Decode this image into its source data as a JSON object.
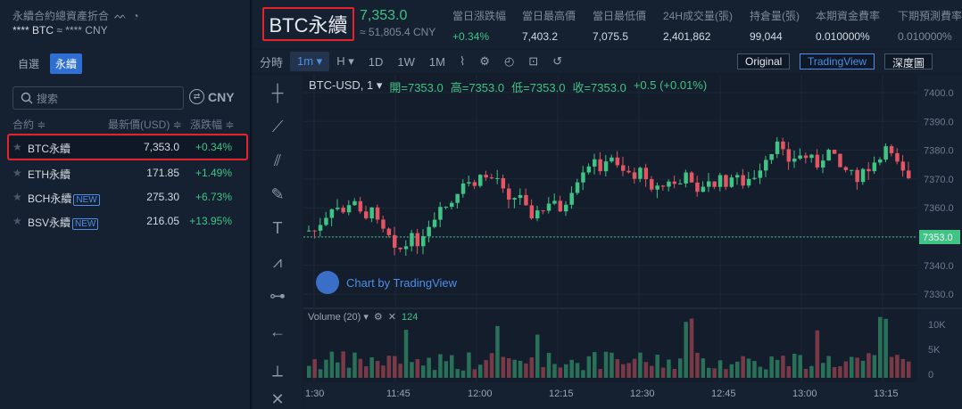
{
  "sidebar": {
    "title": "永續合約總資產折合",
    "balance_btc": "**** BTC",
    "balance_cny": "≈ **** CNY",
    "tabs": [
      {
        "label": "自選"
      },
      {
        "label": "永續"
      }
    ],
    "search_placeholder": "搜索",
    "currency": "CNY",
    "columns": {
      "contract": "合約 ≑",
      "price": "最新價(USD) ≑",
      "change": "漲跌幅 ≑"
    },
    "rows": [
      {
        "name": "BTC永續",
        "new": "",
        "price": "7,353.0",
        "change": "+0.34%"
      },
      {
        "name": "ETH永續",
        "new": "",
        "price": "171.85",
        "change": "+1.49%"
      },
      {
        "name": "BCH永續",
        "new": "NEW",
        "price": "275.30",
        "change": "+6.73%"
      },
      {
        "name": "BSV永續",
        "new": "NEW",
        "price": "216.05",
        "change": "+13.95%"
      }
    ]
  },
  "header": {
    "symbol": "BTC永續",
    "last_price": "7,353.0",
    "last_cny": "≈ 51,805.4 CNY",
    "stats": [
      {
        "label": "當日漲跌幅",
        "value": "+0.34%",
        "color": "#3fc486"
      },
      {
        "label": "當日最高價",
        "value": "7,403.2",
        "color": "#d4dae3"
      },
      {
        "label": "當日最低價",
        "value": "7,075.5",
        "color": "#d4dae3"
      },
      {
        "label": "24H成交量(張)",
        "value": "2,401,862",
        "color": "#d4dae3"
      },
      {
        "label": "持倉量(張)",
        "value": "99,044",
        "color": "#d4dae3"
      },
      {
        "label": "本期資金費率",
        "value": "0.010000%",
        "color": "#d4dae3"
      },
      {
        "label": "下期預測費率",
        "value": "0.010000%",
        "color": "#7d8898"
      }
    ]
  },
  "toolbar": {
    "items": [
      "分時",
      "1m ▾",
      "H ▾",
      "1D",
      "1W",
      "1M"
    ],
    "original": "Original",
    "tradingview": "TradingView",
    "depth": "深度圖"
  },
  "chart_legend": {
    "symbol": "BTC-USD, 1 ▾",
    "open": "開=7353.0",
    "high": "高=7353.0",
    "low": "低=7353.0",
    "close": "收=7353.0",
    "change": "+0.5 (+0.01%)",
    "volume_label": "Volume (20) ▾",
    "volume_value": "124",
    "watermark": "Chart by TradingView"
  },
  "chart_data": {
    "type": "candlestick",
    "price_axis": [
      "7400.0",
      "7390.0",
      "7380.0",
      "7370.0",
      "7360.0",
      "7350.0",
      "7340.0",
      "7330.0"
    ],
    "current_price": "7353.0",
    "volume_axis": [
      "10K",
      "5K",
      "0"
    ],
    "time_axis": [
      "1:30",
      "11:45",
      "12:00",
      "12:15",
      "12:30",
      "12:45",
      "13:00",
      "13:15"
    ]
  },
  "colors": {
    "up": "#3fc486",
    "down": "#e25563",
    "accent": "#2f6fd3"
  }
}
